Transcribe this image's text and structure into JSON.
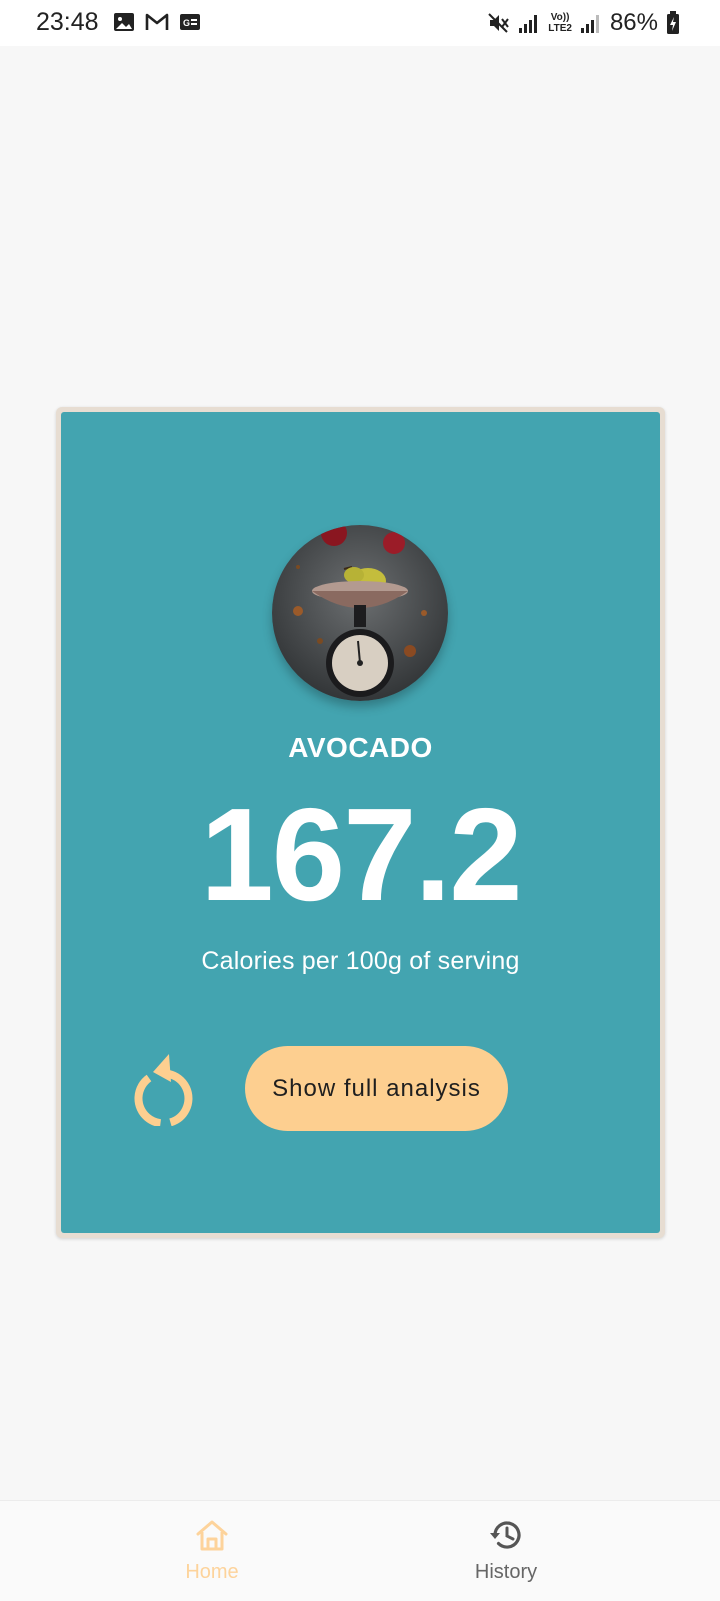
{
  "status_bar": {
    "time": "23:48",
    "network_label_top": "Vo))",
    "network_label_bottom": "LTE2",
    "battery": "86%",
    "left_icons": [
      "gallery-icon",
      "gmail-icon",
      "news-icon"
    ],
    "right_icons": [
      "mute-icon",
      "signal-icon",
      "signal-icon",
      "battery-charging-icon"
    ]
  },
  "card": {
    "food_name": "AVOCADO",
    "calories": "167.2",
    "caption": "Calories per 100g of serving",
    "analysis_button": "Show full analysis",
    "reset_icon": "refresh-icon",
    "image_icon": "kitchen-scale-with-pear"
  },
  "bottom_nav": {
    "items": [
      {
        "label": "Home",
        "icon": "home-icon",
        "active": true
      },
      {
        "label": "History",
        "icon": "history-icon",
        "active": false
      }
    ]
  },
  "colors": {
    "card_background": "#43a4b0",
    "card_border": "#e7ddd2",
    "accent": "#fdcf90",
    "nav_active": "#fdd39b",
    "nav_inactive": "#666666"
  }
}
